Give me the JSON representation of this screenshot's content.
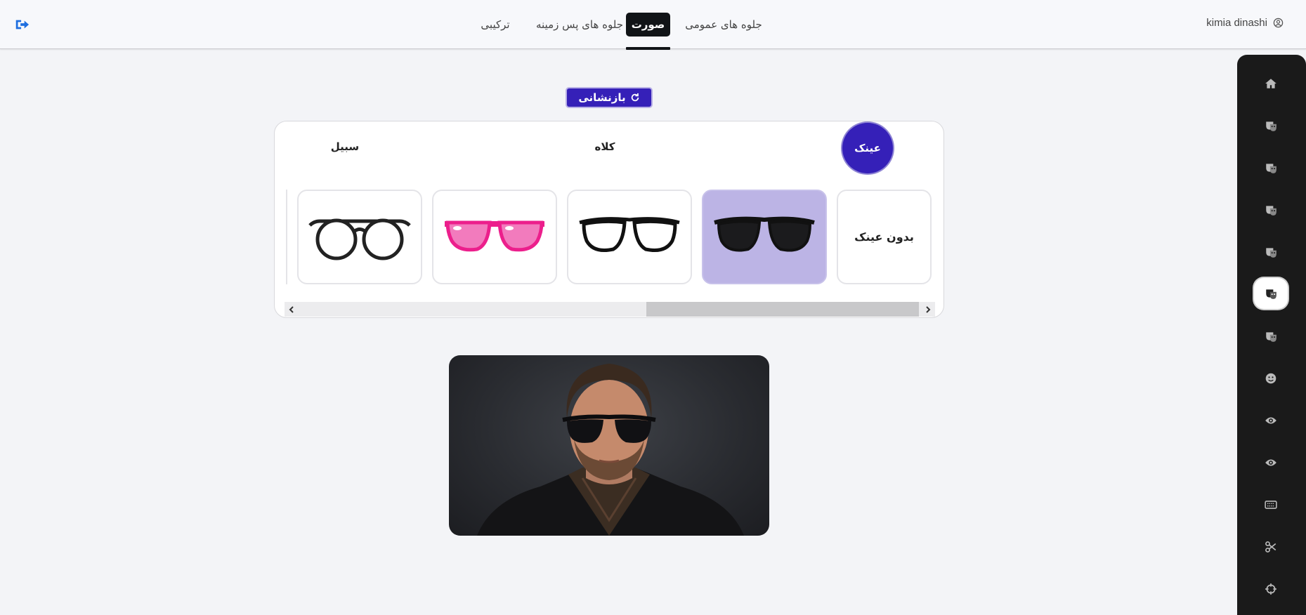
{
  "header": {
    "user_name": "kimia dinashi",
    "tabs": [
      {
        "label": "ترکیبی"
      },
      {
        "label": "جلوه های پس زمینه"
      },
      {
        "label": "صورت"
      },
      {
        "label": "جلوه های عمومی"
      }
    ],
    "active_tab": "صورت"
  },
  "toolbar": {
    "reset_label": "بازنشانی"
  },
  "categories": [
    {
      "label": "عینک",
      "active": true
    },
    {
      "label": "کلاه",
      "active": false
    },
    {
      "label": "سبیل",
      "active": false
    }
  ],
  "items": [
    {
      "label": "بدون عینک",
      "type": "none"
    },
    {
      "name": "black-sunglasses",
      "selected": true
    },
    {
      "name": "clear-wayfarer-glasses"
    },
    {
      "name": "pink-sunglasses"
    },
    {
      "name": "round-black-glasses"
    }
  ],
  "sidebar": {
    "icons": [
      "home-icon",
      "mask-icon",
      "mask-icon",
      "mask-icon",
      "mask-icon",
      "mask-icon",
      "mask-icon",
      "face-icon",
      "eye-icon",
      "eye-icon",
      "keyboard-icon",
      "scissors-icon",
      "crosshair-icon"
    ],
    "active_index": 5
  },
  "colors": {
    "accent": "#3520b8",
    "selected_item": "#bcb4e5",
    "sidebar_bg": "#1a1a1a",
    "logout_icon": "#1f6fe0"
  }
}
